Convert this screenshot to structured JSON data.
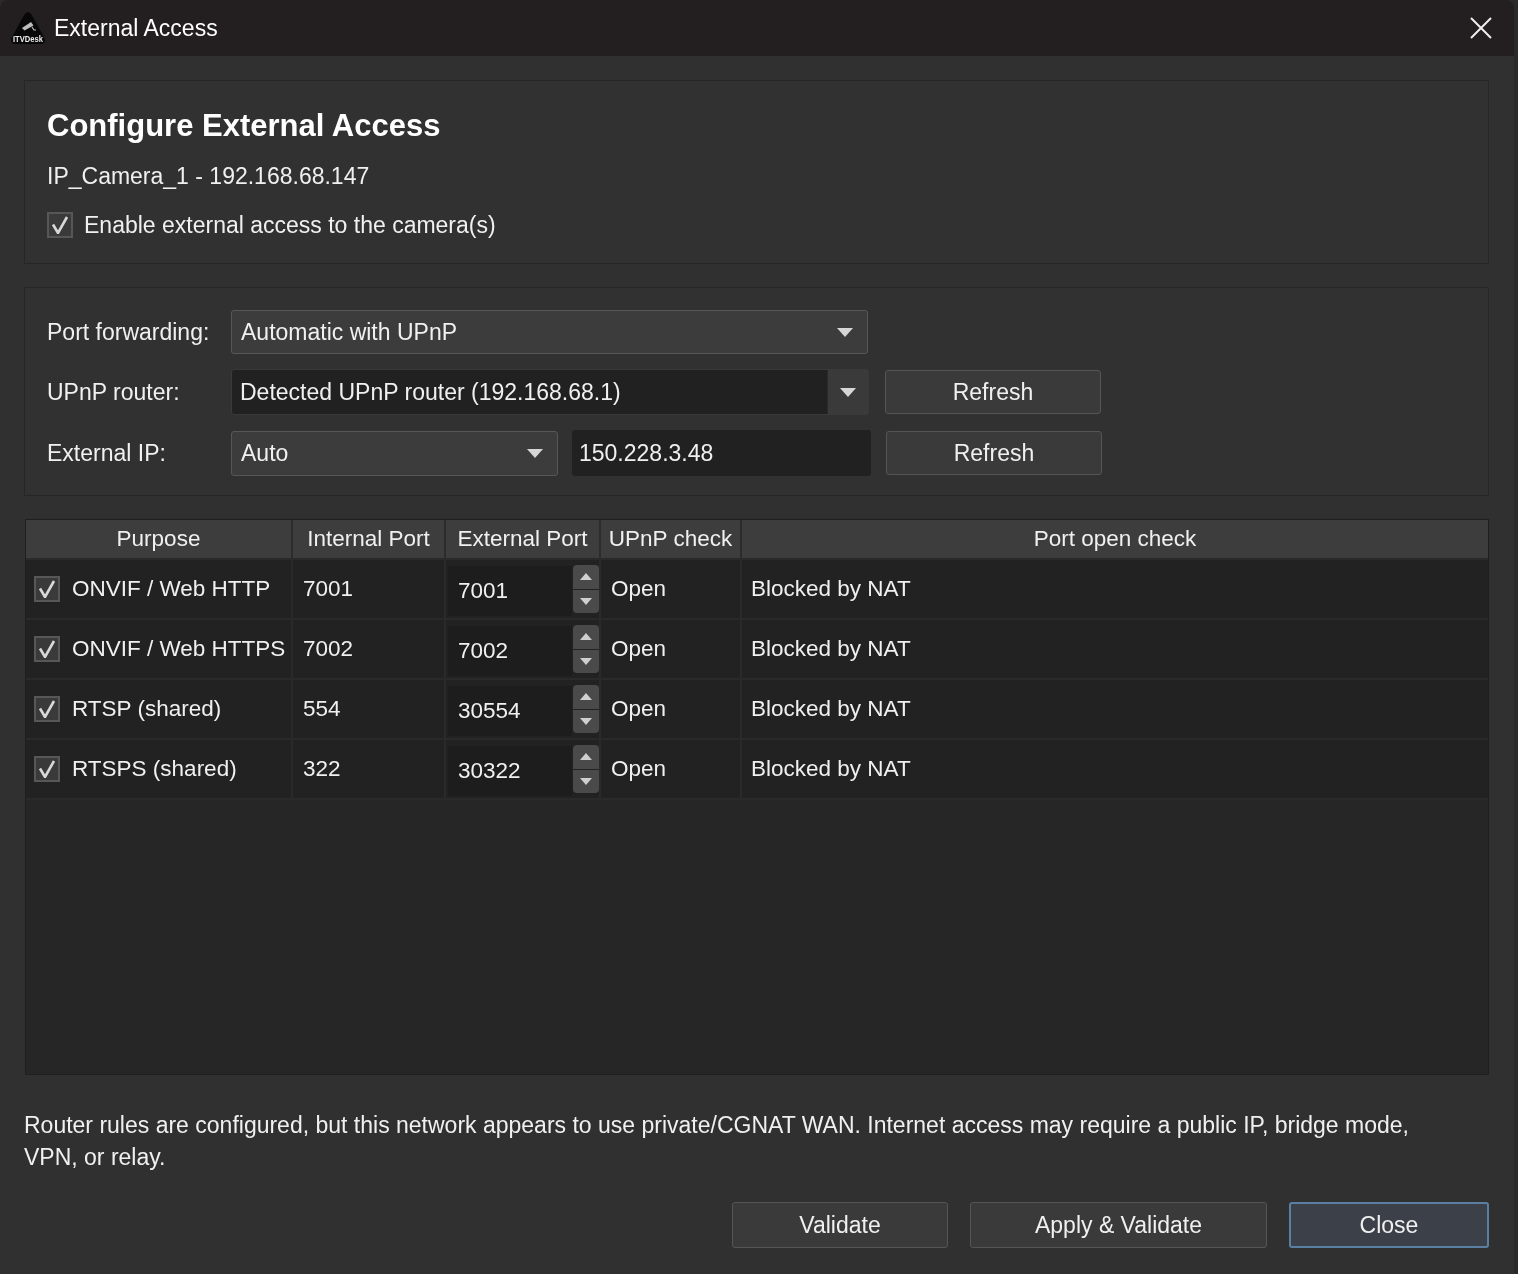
{
  "window": {
    "title": "External Access",
    "logo_text": "ITVDesk"
  },
  "header": {
    "title": "Configure External Access",
    "device": "IP_Camera_1 - 192.168.68.147",
    "enable": {
      "label": "Enable external access to the camera(s)",
      "checked": true
    }
  },
  "settings": [
    {
      "kind": "combo",
      "label": "Port forwarding:",
      "value": "Automatic with UPnP"
    },
    {
      "kind": "editable-combo",
      "label": "UPnP router:",
      "value": "Detected UPnP router (192.168.68.1)",
      "button": "Refresh"
    },
    {
      "kind": "combo-field",
      "label": "External IP:",
      "value": "Auto",
      "field_value": "150.228.3.48",
      "button": "Refresh"
    }
  ],
  "table": {
    "columns": [
      "Purpose",
      "Internal Port",
      "External Port",
      "UPnP check",
      "Port open check"
    ],
    "rows": [
      {
        "checked": true,
        "purpose": "ONVIF / Web HTTP",
        "internal_port": "7001",
        "external_port": "7001",
        "upnp_check": "Open",
        "port_open_check": "Blocked by NAT"
      },
      {
        "checked": true,
        "purpose": "ONVIF / Web HTTPS",
        "internal_port": "7002",
        "external_port": "7002",
        "upnp_check": "Open",
        "port_open_check": "Blocked by NAT"
      },
      {
        "checked": true,
        "purpose": "RTSP (shared)",
        "internal_port": "554",
        "external_port": "30554",
        "upnp_check": "Open",
        "port_open_check": "Blocked by NAT"
      },
      {
        "checked": true,
        "purpose": "RTSPS (shared)",
        "internal_port": "322",
        "external_port": "30322",
        "upnp_check": "Open",
        "port_open_check": "Blocked by NAT"
      }
    ]
  },
  "message": "Router rules are configured, but this network appears to use private/CGNAT WAN. Internet access may require a public IP, bridge mode, VPN, or relay.",
  "buttons": [
    {
      "label": "Validate",
      "default": false
    },
    {
      "label": "Apply & Validate",
      "default": false
    },
    {
      "label": "Close",
      "default": true
    }
  ]
}
